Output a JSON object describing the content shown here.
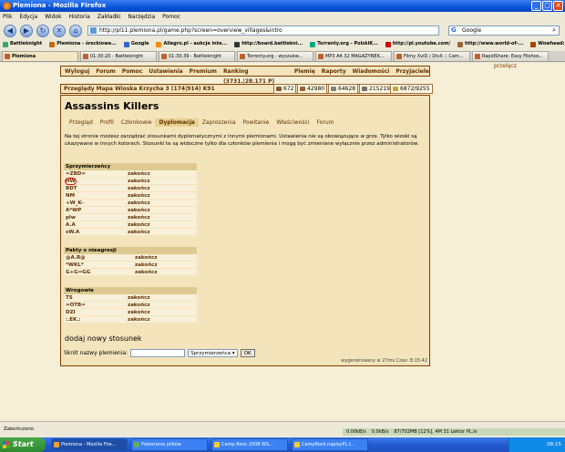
{
  "window": {
    "title": "Plemiona - Mozilla Firefox"
  },
  "menu": [
    "Plik",
    "Edycja",
    "Widok",
    "Historia",
    "Zakładki",
    "Narzędzia",
    "Pomoc"
  ],
  "url": "http://pl11.plemiona.pl/game.php?screen=overview_villages&intro",
  "search": {
    "placeholder": "Google"
  },
  "bookmarks": [
    "Battleknight",
    "Plemiona - śreckiowe...",
    "Google",
    "Allegro.pl - aukcje inte...",
    "http://board.battlekni...",
    "Torrenty.org - PolskiK...",
    "http://pl.youtube.com/",
    "http://www.world-of-...",
    "Wowhead: Flagged fo..."
  ],
  "tabs": [
    "Plemiona",
    "01:30:20 - Battleknight",
    "01:30:39 - Battleknight",
    "Torrenty.org - wyszukw...",
    "MP3 A4 32 MAGAZYNEK...",
    "Filmy XviD / DivX :: Cam...",
    "RapidShare: Easy Filehos..."
  ],
  "game": {
    "menu": [
      "Wyloguj",
      "Forum",
      "Pomoc",
      "Ustawienia",
      "Premium",
      "Ranking (3731.|28.171 P)",
      "Plemię",
      "Raporty",
      "Wiadomości",
      "Przyjaciele"
    ],
    "switch": "przełącz",
    "village_bar": "Przeglądy   Mapa    Wioska Krzycha 3 (174|914) K91",
    "resources": [
      {
        "value": "672",
        "color": "#8a5a2a"
      },
      {
        "value": "42980",
        "color": "#a06030"
      },
      {
        "value": "64628",
        "color": "#808080"
      },
      {
        "value": "215219",
        "color": "#707070"
      },
      {
        "value": "6872/9255",
        "color": "#c8a040"
      }
    ],
    "tribe_name": "Assassins Killers",
    "subtabs": [
      "Przegląd",
      "Profil",
      "Członkowie",
      "Dyplomacja",
      "Zaproszenia",
      "Powitanie",
      "Właściwości",
      "Forum"
    ],
    "active_subtab": "Dyplomacja",
    "description": "Na tej stronie możesz zarządzać stosunkami dyplomatycznymi z innymi plemionami. Ustawienia nie są obowiązujące w grze. Tylko wioski są ukazywane w innych kolorach. Stosunki te są widoczne tylko dla członków plemienia i mogą być zmieniane wyłącznie przez administratorów.",
    "end_label": "zakończ",
    "allies_title": "Sprzymierzeńcy",
    "allies": [
      "=ZBD=",
      "HW",
      "BDT",
      "NM",
      "+W_K-",
      "A*WP",
      "plw",
      "A.A",
      "sW.A"
    ],
    "nap_title": "Pakty o nieagresji",
    "nap": [
      "@A.R@",
      "*WKL*",
      "G+G=GG"
    ],
    "enemies_title": "Wrogowie",
    "enemies": [
      "TS",
      "=OTB=",
      "DZI",
      ":.EK.:"
    ],
    "add_title": "dodaj nowy stosunek",
    "form_label": "Skrót nazwy plemienia:",
    "form_select": "Sprzymierzeńca",
    "ok": "OK",
    "footer": "wygenerowany w 27ms Czas: 8:15:42"
  },
  "status": "Zakończono",
  "speeds": [
    "0.00kB/s",
    "0.0kB/s",
    "87/702MB [12%], 4M 31 Lektor PL.Iv"
  ],
  "taskbar": {
    "start": "Start",
    "tasks": [
      "Plemiona - Mozilla Fire...",
      "Pobieranie plików",
      "Camp.Rock.2008.WS...",
      "CampRock.napisyPL.t..."
    ],
    "clock": "08:15"
  }
}
